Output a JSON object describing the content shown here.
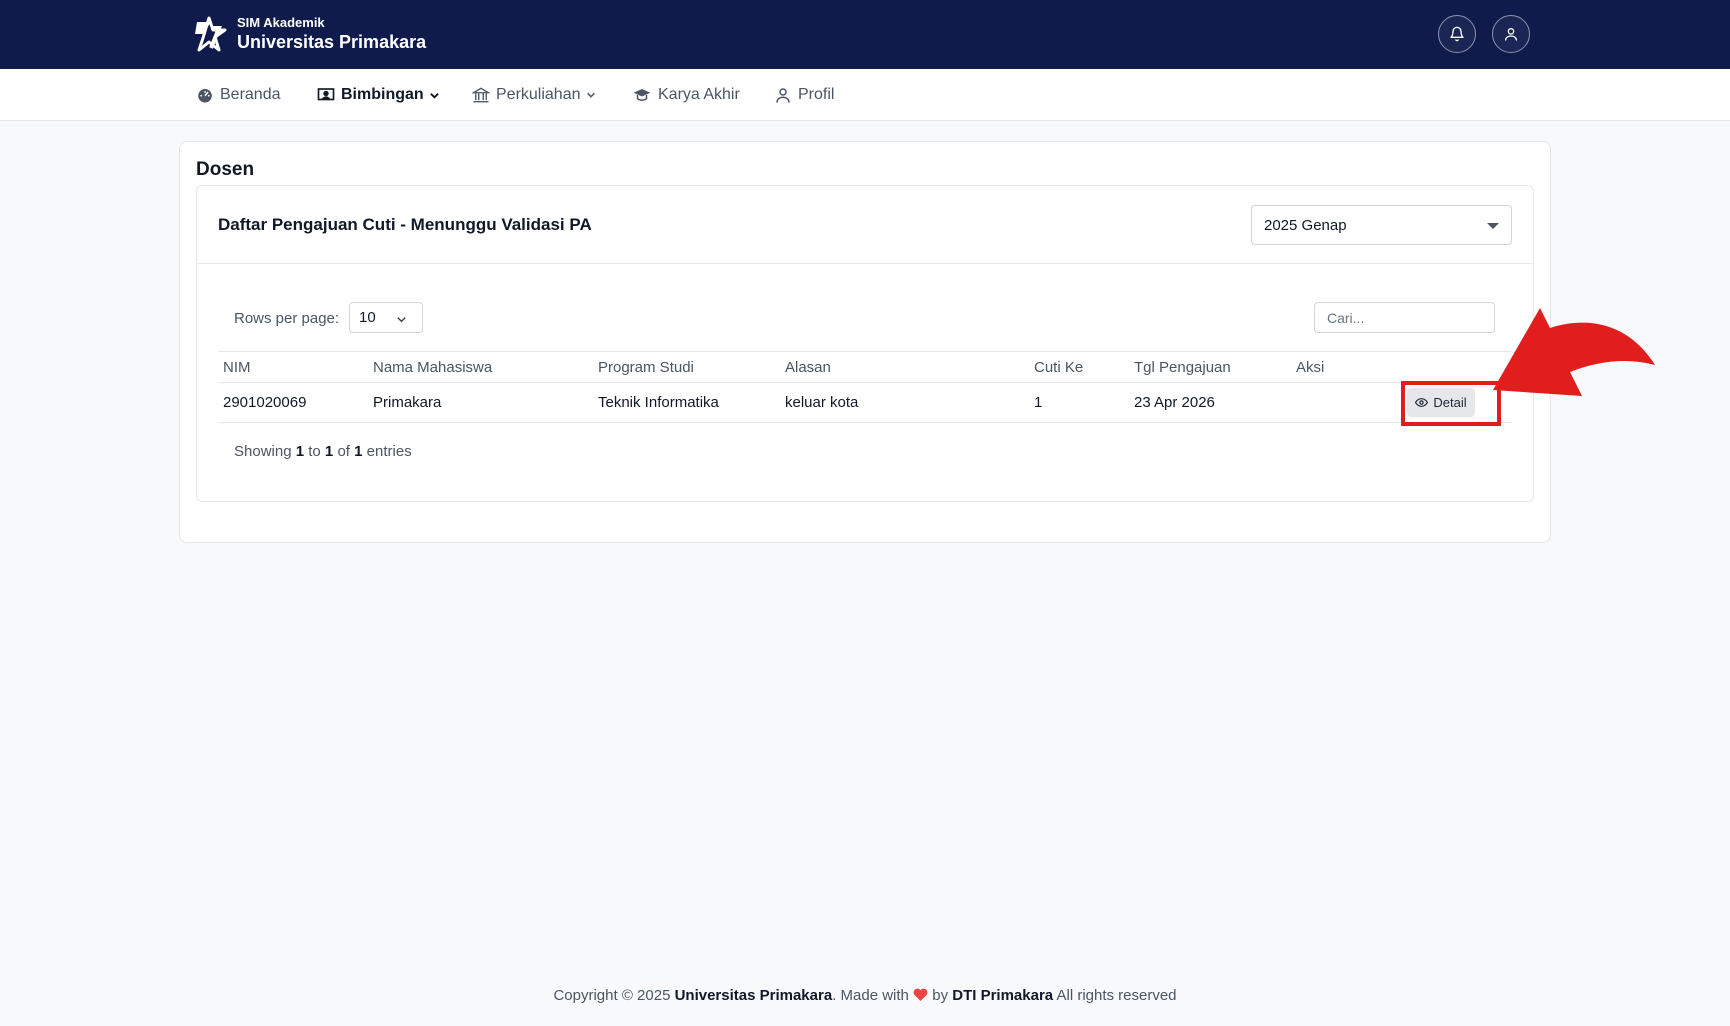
{
  "brand": {
    "subtitle": "SIM Akademik",
    "title": "Universitas Primakara"
  },
  "topbar": {
    "notification_icon": "bell-icon",
    "user_icon": "user-icon"
  },
  "nav": [
    {
      "label": "Beranda",
      "icon": "dashboard-icon",
      "active": false,
      "dropdown": false
    },
    {
      "label": "Bimbingan",
      "icon": "presentation-icon",
      "active": true,
      "dropdown": true
    },
    {
      "label": "Perkuliahan",
      "icon": "building-icon",
      "active": false,
      "dropdown": true
    },
    {
      "label": "Karya Akhir",
      "icon": "graduation-cap-icon",
      "active": false,
      "dropdown": false
    },
    {
      "label": "Profil",
      "icon": "user-icon",
      "active": false,
      "dropdown": false
    }
  ],
  "page": {
    "title": "Dosen"
  },
  "panel": {
    "title": "Daftar Pengajuan Cuti - Menunggu Validasi PA",
    "semester": "2025 Genap"
  },
  "table_controls": {
    "rows_label": "Rows per page:",
    "rows_value": "10",
    "search_placeholder": "Cari..."
  },
  "table": {
    "columns": [
      "NIM",
      "Nama Mahasiswa",
      "Program Studi",
      "Alasan",
      "Cuti Ke",
      "Tgl Pengajuan",
      "Aksi"
    ],
    "rows": [
      {
        "nim": "2901020069",
        "nama": "Primakara",
        "prodi": "Teknik Informatika",
        "alasan": "keluar kota",
        "cuti_ke": "1",
        "tgl": "23 Apr 2026",
        "action_label": "Detail"
      }
    ]
  },
  "pagination": {
    "prefix": "Showing",
    "from": "1",
    "to_word": "to",
    "to": "1",
    "of_word": "of",
    "total": "1",
    "suffix": "entries"
  },
  "footer": {
    "copyright": "Copyright © 2025",
    "org": "Universitas Primakara",
    "made_with": ". Made with",
    "by": "by",
    "team": "DTI Primakara",
    "rights": "All rights reserved"
  },
  "colors": {
    "topbar": "#0f1b4b",
    "highlight": "#e11d1d",
    "heart": "#ef4444"
  }
}
